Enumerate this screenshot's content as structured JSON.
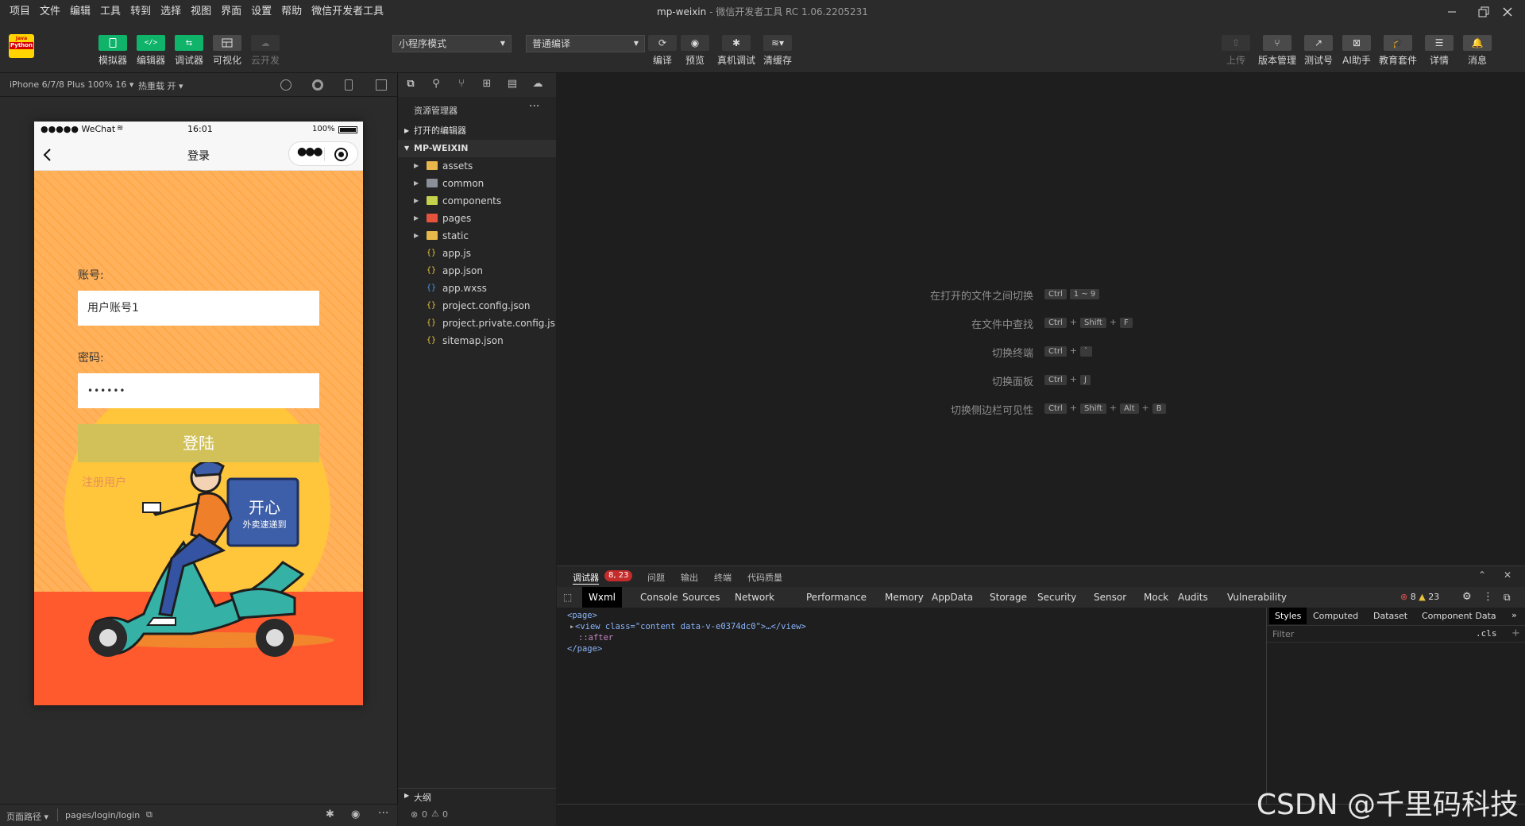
{
  "menu": [
    "项目",
    "文件",
    "编辑",
    "工具",
    "转到",
    "选择",
    "视图",
    "界面",
    "设置",
    "帮助",
    "微信开发者工具"
  ],
  "window": {
    "project": "mp-weixin",
    "separator": " - ",
    "app": "微信开发者工具 RC 1.06.2205231"
  },
  "logo": {
    "line1": "Java",
    "line2": "Python"
  },
  "toolbar": {
    "simulator": "模拟器",
    "editor": "编辑器",
    "debugger": "调试器",
    "visual": "可视化",
    "cloud": "云开发",
    "mode": "小程序模式",
    "compile_mode": "普通编译",
    "compile": "编译",
    "preview": "预览",
    "remote_debug": "真机调试",
    "clear_cache": "清缓存",
    "upload": "上传",
    "version": "版本管理",
    "test_account": "测试号",
    "ai": "AI助手",
    "edu": "教育套件",
    "details": "详情",
    "messages": "消息"
  },
  "simbar": {
    "device": "iPhone 6/7/8 Plus 100% 16",
    "hot_reload": "热重载 开"
  },
  "phone": {
    "carrier": "●●●●● WeChat",
    "time": "16:01",
    "battery": "100%",
    "title": "登录",
    "account_label": "账号:",
    "account_value": "用户账号1",
    "password_label": "密码:",
    "password_value": "••••••",
    "login": "登陆",
    "register": "注册用户",
    "badge_line1": "开心",
    "badge_line2": "外卖速递到"
  },
  "explorer": {
    "header": "资源管理器",
    "open_editors": "打开的编辑器",
    "root": "MP-WEIXIN",
    "items": [
      {
        "name": "assets",
        "type": "folder",
        "color": "#e8b84a"
      },
      {
        "name": "common",
        "type": "folder",
        "color": "#8a8f99"
      },
      {
        "name": "components",
        "type": "folder",
        "color": "#c5d14a"
      },
      {
        "name": "pages",
        "type": "folder",
        "color": "#e5533d"
      },
      {
        "name": "static",
        "type": "folder",
        "color": "#e8b84a"
      },
      {
        "name": "app.js",
        "type": "file",
        "color": "#e8c43a"
      },
      {
        "name": "app.json",
        "type": "file",
        "color": "#e8c43a"
      },
      {
        "name": "app.wxss",
        "type": "file",
        "color": "#4a9be8"
      },
      {
        "name": "project.config.json",
        "type": "file",
        "color": "#e8c43a"
      },
      {
        "name": "project.private.config.js...",
        "type": "file",
        "color": "#e8c43a"
      },
      {
        "name": "sitemap.json",
        "type": "file",
        "color": "#e8c43a"
      }
    ],
    "outline": "大纲",
    "status_errors": "0",
    "status_warnings": "0"
  },
  "hints": [
    {
      "label": "在打开的文件之间切换",
      "keys": [
        "Ctrl",
        "1 ~ 9"
      ],
      "join": [
        ""
      ]
    },
    {
      "label": "在文件中查找",
      "keys": [
        "Ctrl",
        "Shift",
        "F"
      ],
      "join": [
        "+",
        "+"
      ]
    },
    {
      "label": "切换终端",
      "keys": [
        "Ctrl",
        "`"
      ],
      "join": [
        "+"
      ]
    },
    {
      "label": "切换面板",
      "keys": [
        "Ctrl",
        "J"
      ],
      "join": [
        "+"
      ]
    },
    {
      "label": "切换侧边栏可见性",
      "keys": [
        "Ctrl",
        "Shift",
        "Alt",
        "B"
      ],
      "join": [
        "+",
        "+",
        "+"
      ]
    }
  ],
  "debug": {
    "tabs": [
      "调试器",
      "问题",
      "输出",
      "终端",
      "代码质量"
    ],
    "badge": "8, 23",
    "devtabs": [
      "Wxml",
      "Console",
      "Sources",
      "Network",
      "Performance",
      "Memory",
      "AppData",
      "Storage",
      "Security",
      "Sensor",
      "Mock",
      "Audits",
      "Vulnerability"
    ],
    "errors": "8",
    "warnings": "23",
    "code": [
      "<page>",
      "<view class=\"content data-v-e0374dc0\">…</view>",
      "::after",
      "</page>"
    ],
    "styles_tabs": [
      "Styles",
      "Computed",
      "Dataset",
      "Component Data"
    ],
    "filter_placeholder": "Filter",
    "cls": ".cls"
  },
  "bottom": {
    "path_label": "页面路径",
    "path": "pages/login/login"
  },
  "watermark": "CSDN @千里码科技"
}
